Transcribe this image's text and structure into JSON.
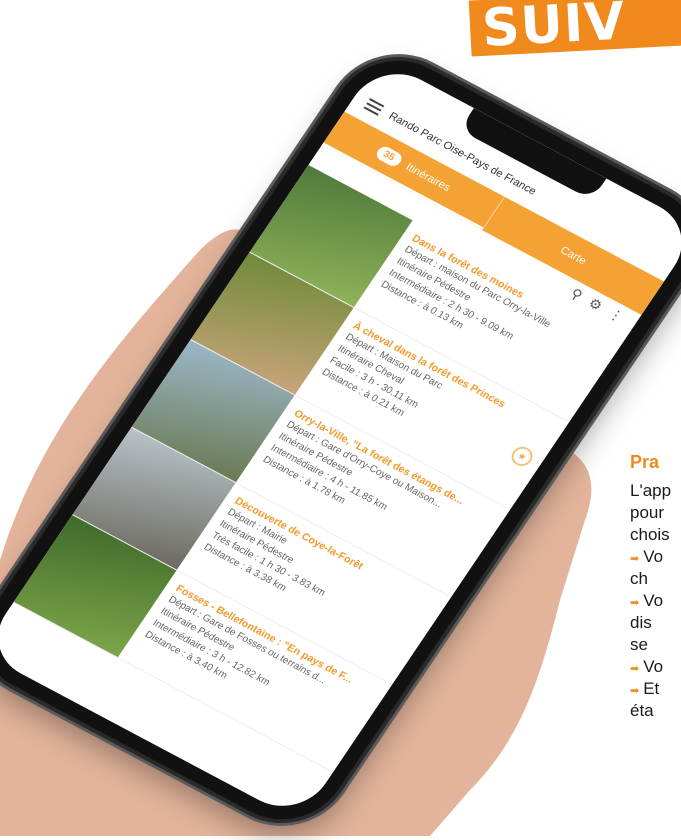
{
  "banner": {
    "text": "SUIV"
  },
  "app": {
    "title": "Rando Parc Oise-Pays de France",
    "tabs": [
      {
        "count": "35",
        "label": "Itinéraires"
      },
      {
        "label": "Carte"
      }
    ],
    "toolbar_icons": [
      "search-icon",
      "gear-icon",
      "more-vertical-icon"
    ]
  },
  "routes": [
    {
      "title": "Dans la forêt des moines",
      "depart": "Départ : maison du Parc Orry-la-Ville",
      "type": "Itinéraire Pédestre",
      "level": "Intermédiaire : 2 h 30 - 9.09 km",
      "distance": "Distance : à 0.13 km",
      "thumb": [
        "#4f7a3a",
        "#8fb35a"
      ]
    },
    {
      "title": "À cheval dans la forêt des Princes",
      "depart": "Départ : Maison du Parc",
      "type": "Itinéraire Cheval",
      "level": "Facile : 3 h - 30.11 km",
      "distance": "Distance : à 0.21 km",
      "thumb": [
        "#6f8a3a",
        "#c9a47a"
      ],
      "favorite": true
    },
    {
      "title": "Orry-la-Ville, \"La forêt des étangs de...",
      "depart": "Départ : Gare d'Orry-Coye ou Maison...",
      "type": "Itinéraire Pédestre",
      "level": "Intermédiaire : 4 h - 11.85 km",
      "distance": "Distance : à 1.78 km",
      "thumb": [
        "#9bb7c9",
        "#6a7a52"
      ]
    },
    {
      "title": "Découverte de Coye-la-Forêt",
      "depart": "Départ : Mairie",
      "type": "Itinéraire Pédestre",
      "level": "Très facile : 1 h 30 - 3.83 km",
      "distance": "Distance : à 3.38 km",
      "thumb": [
        "#b9c3c9",
        "#6c6a60"
      ]
    },
    {
      "title": "Fosses - Bellefontaine : \"En pays de F...",
      "depart": "Départ : Gare de Fosses ou terrains d...",
      "type": "Itinéraire Pédestre",
      "level": "Intermédiaire : 3 h - 12.82 km",
      "distance": "Distance : à 3.40 km",
      "thumb": [
        "#3f6a2a",
        "#7da54a"
      ]
    }
  ],
  "article": {
    "heading": "Pra",
    "lines": [
      "L'app",
      "pour",
      "chois"
    ],
    "bullets": [
      "Vo",
      "ch",
      "Vo",
      "dis",
      "se",
      "Vo",
      "Et",
      "éta"
    ]
  }
}
